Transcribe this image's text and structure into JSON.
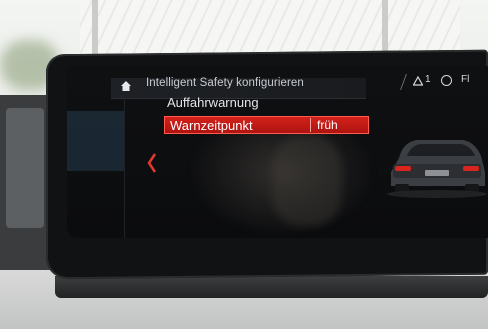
{
  "screen": {
    "breadcrumb": "Intelligent Safety konfigurieren",
    "status": {
      "warning_count": "1",
      "trailing_text": "Fl"
    },
    "menu": {
      "item_1": "Auffahrwarnung",
      "selected_label": "Warnzeitpunkt",
      "selected_value": "früh"
    }
  },
  "colors": {
    "selection": "#c81a15",
    "screen_bg": "#0d0e10",
    "text": "#e3e6ea"
  },
  "icons": [
    "home-icon",
    "warning-triangle-icon",
    "navigation-icon",
    "back-chevron-icon",
    "car-icon"
  ]
}
